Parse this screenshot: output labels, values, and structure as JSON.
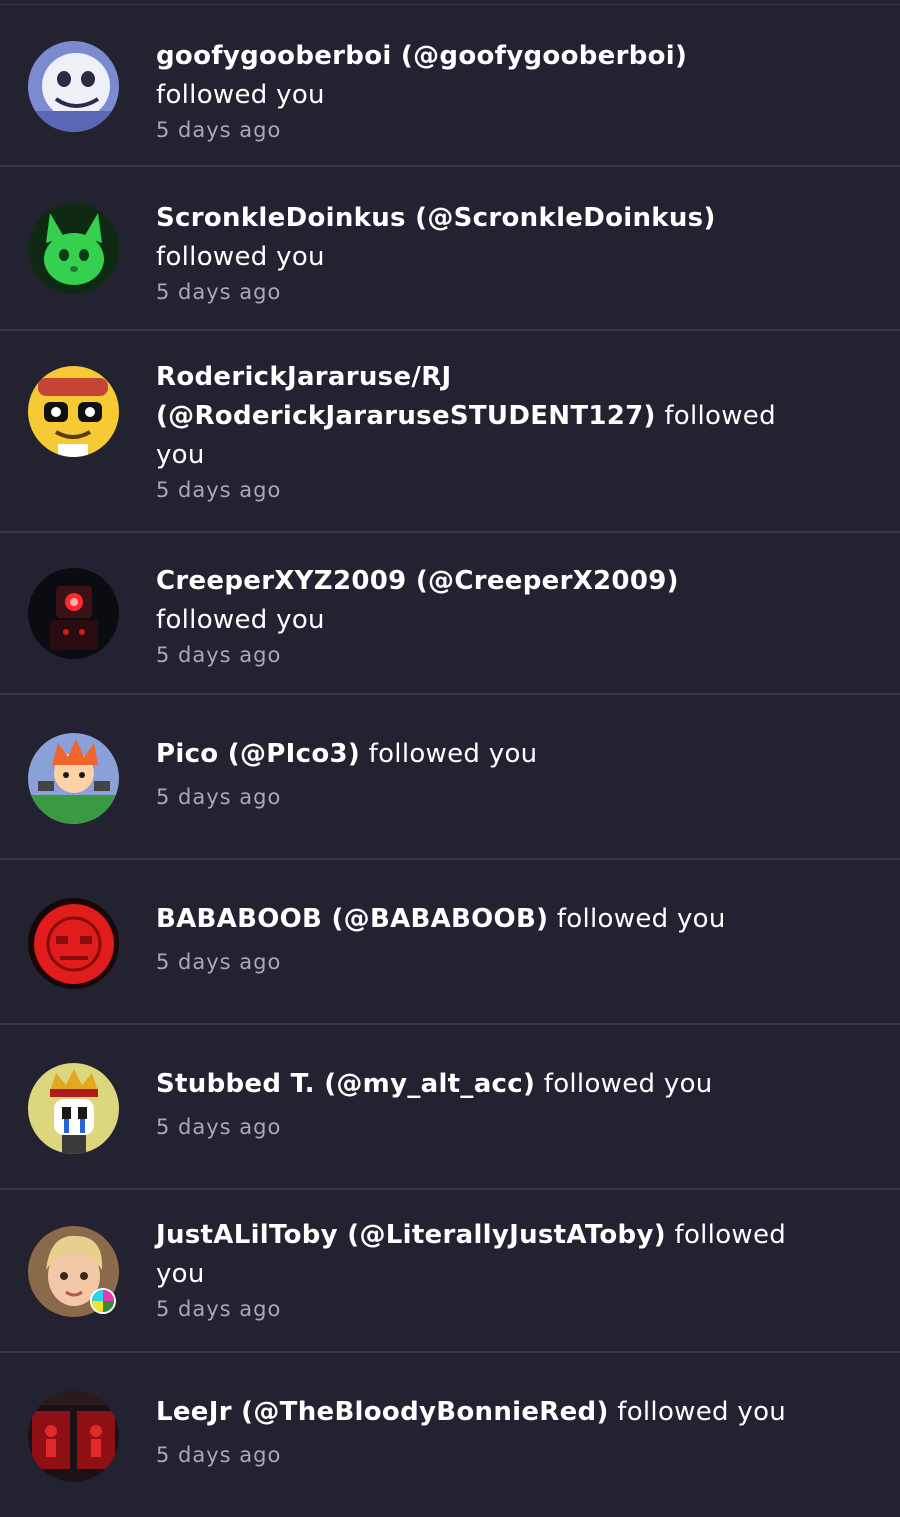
{
  "notifications": [
    {
      "name": "goofygooberboi (@goofygooberboi)",
      "action": "followed you",
      "time": "5 days ago",
      "avatar_icon": "skeleton-avatar-icon",
      "avatar_color": "#8ea0d8"
    },
    {
      "name": "ScronkleDoinkus (@ScronkleDoinkus)",
      "action": "followed you",
      "time": "5 days ago",
      "avatar_icon": "green-cat-avatar-icon",
      "avatar_color": "#31c94a"
    },
    {
      "name": "RoderickJararuse/RJ (@RoderickJararuseSTUDENT127)",
      "action": "followed you",
      "time": "5 days ago",
      "avatar_icon": "yellow-character-avatar-icon",
      "avatar_color": "#f3c52b"
    },
    {
      "name": "CreeperXYZ2009 (@CreeperX2009)",
      "action": "followed you",
      "time": "5 days ago",
      "avatar_icon": "red-robot-avatar-icon",
      "avatar_color": "#b2151a"
    },
    {
      "name": "Pico (@PIco3)",
      "action": "followed you",
      "time": "5 days ago",
      "avatar_icon": "pico-avatar-icon",
      "avatar_color": "#f06a2a"
    },
    {
      "name": "BABABOOB (@BABABOOB)",
      "action": "followed you",
      "time": "5 days ago",
      "avatar_icon": "red-face-avatar-icon",
      "avatar_color": "#e31a1a"
    },
    {
      "name": "Stubbed T. (@my_alt_acc)",
      "action": "followed you",
      "time": "5 days ago",
      "avatar_icon": "crowned-character-avatar-icon",
      "avatar_color": "#d9d37a"
    },
    {
      "name": "JustALilToby (@LiterallyJustAToby)",
      "action": "followed you",
      "time": "5 days ago",
      "avatar_icon": "blond-character-avatar-icon",
      "avatar_color": "#d8b27a"
    },
    {
      "name": "LeeJr (@TheBloodyBonnieRed)",
      "action": "followed you",
      "time": "5 days ago",
      "avatar_icon": "red-panels-avatar-icon",
      "avatar_color": "#8e1014"
    }
  ]
}
